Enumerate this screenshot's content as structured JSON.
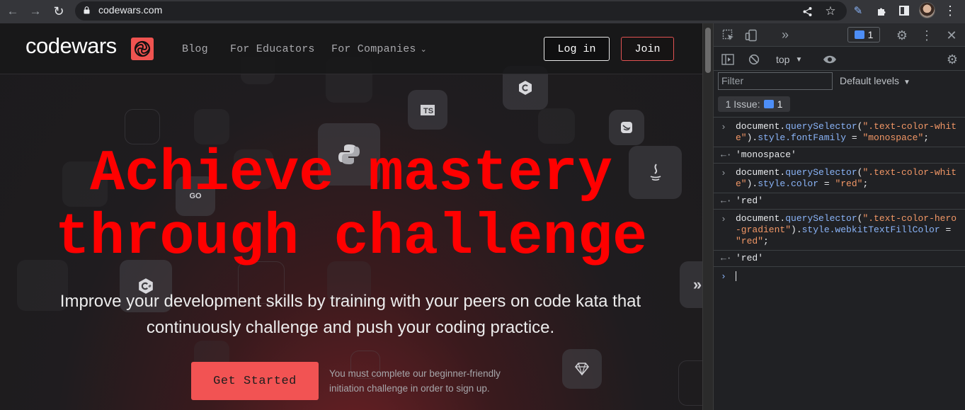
{
  "browser": {
    "url": "codewars.com",
    "nav_icons": [
      "back-arrow-icon",
      "forward-arrow-icon",
      "reload-icon"
    ],
    "toolbar_icons": [
      "share-icon",
      "star-icon",
      "pen-extension-icon",
      "puzzle-extensions-icon",
      "side-panel-icon",
      "profile-avatar",
      "more-vert-icon"
    ]
  },
  "site": {
    "logo": "codewars",
    "nav": {
      "blog": "Blog",
      "educators": "For Educators",
      "companies": "For Companies"
    },
    "login": "Log in",
    "join": "Join",
    "hero_title": "Achieve mastery\nthrough challenge",
    "hero_subtitle": "Improve your development skills by training with your peers on code kata that continuously challenge and push your coding practice.",
    "cta": "Get Started",
    "cta_note": "You must complete our beginner-friendly initiation challenge in order to sign up.",
    "tile_labels": {
      "ts": "TS",
      "go": "GO"
    },
    "colors": {
      "accent": "#ef5350",
      "hero_text": "#ff0000"
    }
  },
  "devtools": {
    "issues_count": "1",
    "context": "top",
    "filter_placeholder": "Filter",
    "levels": "Default levels",
    "issue_label": "1 Issue:",
    "issue_count": "1",
    "console": [
      {
        "prefix": "document.",
        "method": "querySelector",
        "open": "(",
        "selector": "\".text-color-white\"",
        "close": ").",
        "prop": "style.fontFamily",
        "assign": " = ",
        "value": "\"monospace\"",
        "end": ";",
        "result": "'monospace'"
      },
      {
        "prefix": "document.",
        "method": "querySelector",
        "open": "(",
        "selector": "\".text-color-white\"",
        "close": ").",
        "prop": "style.color",
        "assign": " = ",
        "value": "\"red\"",
        "end": ";",
        "result": "'red'"
      },
      {
        "prefix": "document.",
        "method": "querySelector",
        "open": "(",
        "selector": "\".text-color-hero-gradient\"",
        "close": ").",
        "prop": "style.webkitTextFillColor",
        "assign": " = ",
        "value": "\"red\"",
        "end": ";",
        "result": "'red'"
      }
    ]
  }
}
